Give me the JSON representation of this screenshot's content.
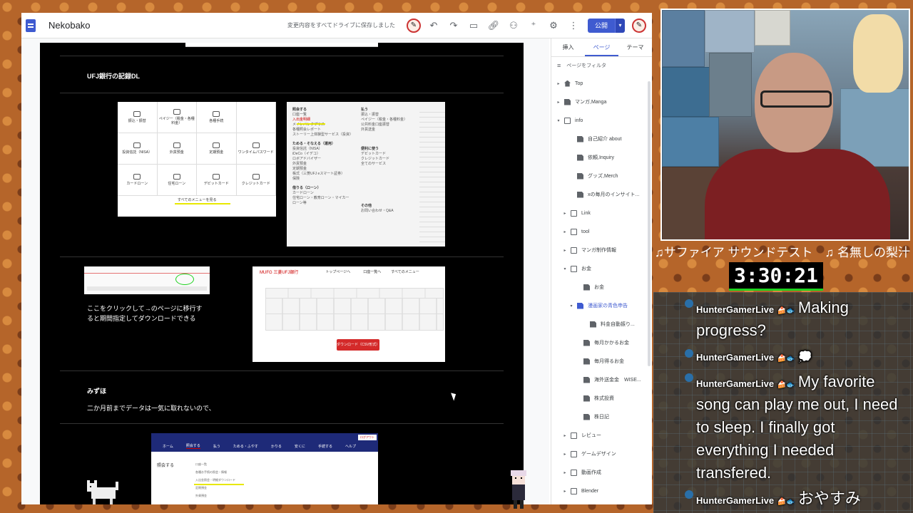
{
  "editor": {
    "site_title": "Nekobako",
    "save_status": "変更内容をすべてドライブに保存しました",
    "publish_label": "公開",
    "toolbar_icons": [
      "avatar-icon",
      "undo-icon",
      "redo-icon",
      "preview-icon",
      "link-icon",
      "share-icon",
      "add-person-icon",
      "settings-icon",
      "more-icon"
    ]
  },
  "content": {
    "section1_heading": "UFJ銀行の記録DL",
    "menu_mock": {
      "cells": [
        "振込・振替",
        "ペイジー（税金・各種料金）",
        "各種手続",
        "",
        "投資信託（NISA）",
        "外貨預金",
        "定期預金",
        "ワンタイムパスワード",
        "カードローン",
        "住宅ローン",
        "デビットカード",
        "クレジットカード"
      ],
      "all_menu_link": "すべてのメニューを見る"
    },
    "list_mock": {
      "col1_title": "照会する",
      "col1": [
        "口座一覧",
        "入出金明細",
        "メインバンクプラス",
        "各種照会レポート",
        "ストーリー上体験型サービス（投資）"
      ],
      "col1b_title": "ためる・そなえる（運用）",
      "col1b": [
        "投資信託（NISA）",
        "iDeCo（イデコ）",
        "ロボアドバイザー",
        "外貨預金",
        "定期預金",
        "株式（三菱UFJ eスマート証券）",
        "保険"
      ],
      "col1c_title": "借りる（ローン）",
      "col1c": [
        "カードローン",
        "住宅ローン・教育ローン・マイカーローン等"
      ],
      "col2_title": "払う",
      "col2": [
        "振込・振替",
        "ペイジー（税金・各種料金）",
        "公共料金口座振替",
        "外貨送金"
      ],
      "col2b_title": "便利に使う",
      "col2b": [
        "デビットカード",
        "クレジットカード",
        "全てのサービス"
      ],
      "col2c_title": "その他",
      "col2c": [
        "お問い合わせ・Q&A"
      ]
    },
    "click_note": "ここをクリックして→のページに移行すると期間指定してダウンロードできる",
    "mufg_bank": "MUFG 三菱UFJ銀行",
    "mufg_nav": [
      "トップページへ",
      "口座一覧へ",
      "すべてのメニュー"
    ],
    "download_button": "ダウンロード（CSV形式）",
    "section2_heading": "みずほ",
    "section2_text": "二か月前までデータは一気に取れないので、",
    "mizuho_nav": [
      "ホーム",
      "照会する",
      "払う",
      "ためる・ふやす",
      "かりる",
      "安くに",
      "手続する",
      "ヘルプ"
    ],
    "mizuho_side": "照会する",
    "mizuho_links": [
      "口座一覧",
      "各種お手続の照会・情報",
      "入出金照会・明細ダウンロード",
      "定期預金",
      "外貨預金"
    ],
    "mizuho_logout": "ログアウト"
  },
  "panel": {
    "tabs": [
      "挿入",
      "ページ",
      "テーマ"
    ],
    "active_tab": 1,
    "filter_placeholder": "ページをフィルタ",
    "pages": [
      {
        "label": "Top",
        "icon": "home",
        "indent": 0,
        "toggle": "▸"
      },
      {
        "label": "マンガ,Manga",
        "icon": "doc",
        "indent": 0,
        "toggle": "▸"
      },
      {
        "label": "info",
        "icon": "folder",
        "indent": 0,
        "toggle": "▾"
      },
      {
        "label": "自己紹介 about",
        "icon": "doc",
        "indent": 2,
        "toggle": ""
      },
      {
        "label": "依頼,Inquiry",
        "icon": "doc",
        "indent": 2,
        "toggle": ""
      },
      {
        "label": "グッズ,Merch",
        "icon": "doc",
        "indent": 2,
        "toggle": ""
      },
      {
        "label": "xの毎月のインサイト...",
        "icon": "hidden",
        "indent": 2,
        "toggle": ""
      },
      {
        "label": "Link",
        "icon": "folder",
        "indent": 1,
        "toggle": "▸"
      },
      {
        "label": "tool",
        "icon": "folder",
        "indent": 1,
        "toggle": "▸"
      },
      {
        "label": "マンガ制作情報",
        "icon": "folder",
        "indent": 1,
        "toggle": "▸"
      },
      {
        "label": "お金",
        "icon": "folder",
        "indent": 1,
        "toggle": "▾"
      },
      {
        "label": "お金",
        "icon": "hidden",
        "indent": 3,
        "toggle": ""
      },
      {
        "label": "漫画家の青色申告",
        "icon": "doc",
        "indent": 2,
        "toggle": "▾",
        "selected": true
      },
      {
        "label": "料金自動振り...",
        "icon": "hidden",
        "indent": 4,
        "toggle": ""
      },
      {
        "label": "毎月かかるお金",
        "icon": "hidden",
        "indent": 3,
        "toggle": ""
      },
      {
        "label": "毎月得るお金",
        "icon": "hidden",
        "indent": 3,
        "toggle": ""
      },
      {
        "label": "海外送金金　WISE...",
        "icon": "hidden",
        "indent": 3,
        "toggle": ""
      },
      {
        "label": "株式投資",
        "icon": "hidden",
        "indent": 3,
        "toggle": ""
      },
      {
        "label": "株日記",
        "icon": "hidden",
        "indent": 3,
        "toggle": ""
      },
      {
        "label": "レビュー",
        "icon": "folder",
        "indent": 1,
        "toggle": "▸"
      },
      {
        "label": "ゲームデザイン",
        "icon": "folder",
        "indent": 1,
        "toggle": "▸"
      },
      {
        "label": "動画作成",
        "icon": "folder",
        "indent": 1,
        "toggle": "▸"
      },
      {
        "label": "Blender",
        "icon": "folder",
        "indent": 1,
        "toggle": "▸"
      }
    ]
  },
  "stream": {
    "song_title": "♫サファイア サウンドテスト　♫ 名無しの梨汁",
    "timer": "3:30:21",
    "chat": [
      {
        "name": "HunterGamerLive",
        "badges": "🍰🐟",
        "message": "Making progress?"
      },
      {
        "name": "HunterGamerLive",
        "badges": "🍰🐟",
        "message": "💭"
      },
      {
        "name": "HunterGamerLive",
        "badges": "🍰🐟",
        "message": "My favorite song can play me out, I need to sleep. I finally got everything I needed transfered."
      },
      {
        "name": "HunterGamerLive",
        "badges": "🍰🐟",
        "message": "おやすみ"
      }
    ]
  },
  "colors": {
    "accent": "#3f5bd0",
    "timer_bar": "#1fd21f",
    "download_button": "#d42a2a"
  }
}
